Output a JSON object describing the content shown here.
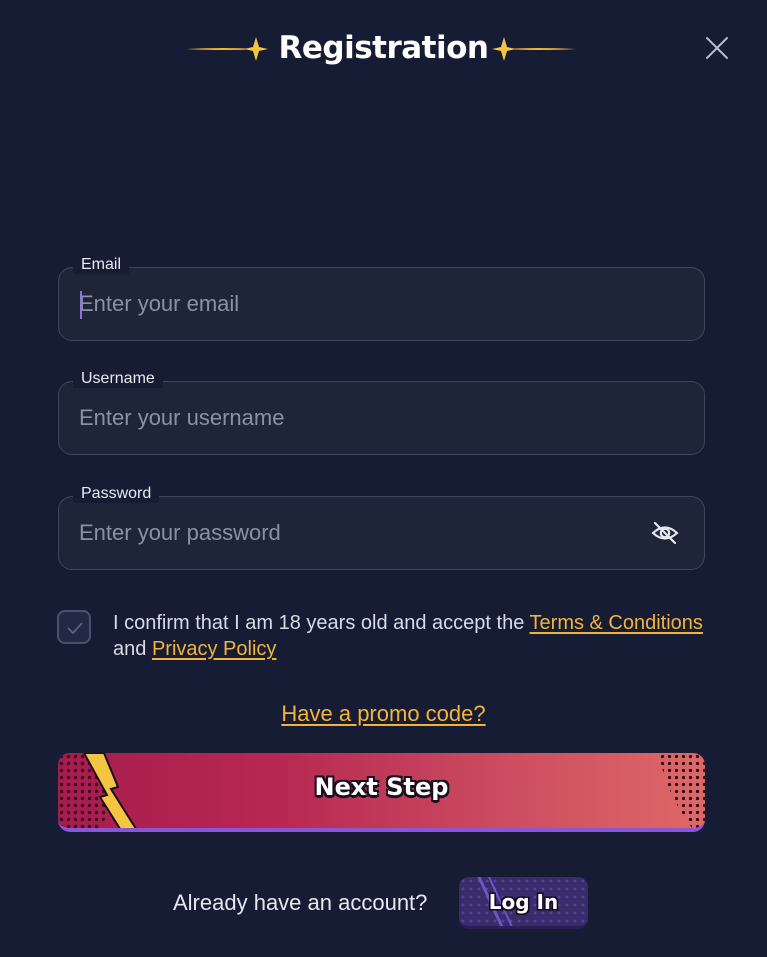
{
  "header": {
    "title": "Registration"
  },
  "form": {
    "email": {
      "label": "Email",
      "placeholder": "Enter your email",
      "value": ""
    },
    "username": {
      "label": "Username",
      "placeholder": "Enter your username",
      "value": ""
    },
    "password": {
      "label": "Password",
      "placeholder": "Enter your password",
      "value": ""
    }
  },
  "consent": {
    "text_before": "I confirm that I am 18 years old and accept the ",
    "terms_link": "Terms & Conditions",
    "text_middle": "and ",
    "privacy_link": "Privacy Policy",
    "checked": false
  },
  "promo_link": "Have a promo code?",
  "next_button": "Next Step",
  "footer": {
    "prompt": "Already have an account?",
    "login_button": "Log In"
  },
  "icons": {
    "close": "close-icon",
    "password_toggle": "eye-slash-icon",
    "checkbox": "check-icon",
    "decor": "sparkle-icon"
  },
  "colors": {
    "background": "#161c33",
    "field_background": "#1f2538",
    "accent_link": "#f2b43c",
    "button_gradient_start": "#a81c4d",
    "button_gradient_end": "#de6866",
    "button_underline": "#8a55d6",
    "login_button": "#3a2b6b"
  }
}
